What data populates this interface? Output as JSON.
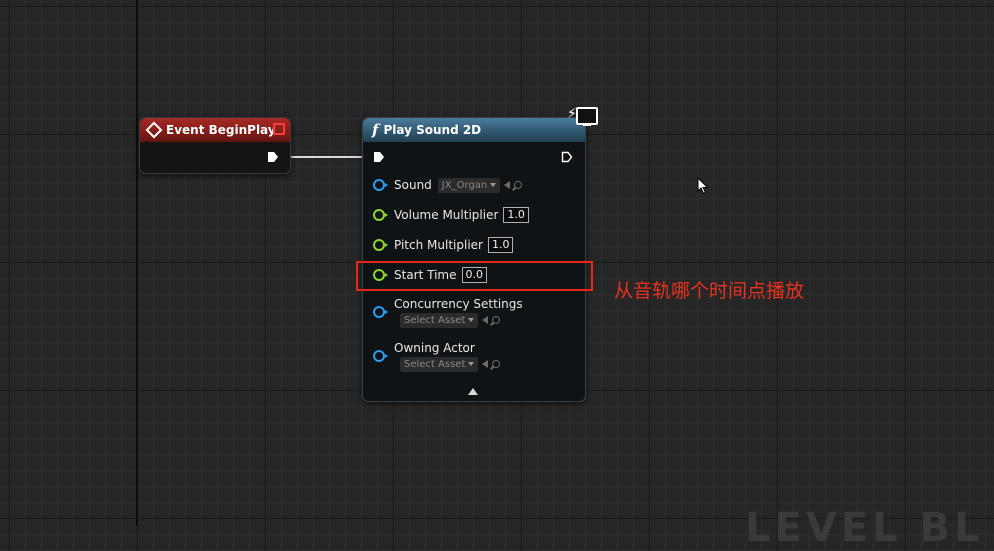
{
  "event_node": {
    "title": "Event BeginPlay"
  },
  "function_node": {
    "title": "Play Sound 2D",
    "icon": "function-icon",
    "pins": {
      "sound": {
        "label": "Sound",
        "value": "JX_Organ"
      },
      "volume_multiplier": {
        "label": "Volume Multiplier",
        "value": "1.0"
      },
      "pitch_multiplier": {
        "label": "Pitch Multiplier",
        "value": "1.0"
      },
      "start_time": {
        "label": "Start Time",
        "value": "0.0"
      },
      "concurrency_settings": {
        "label": "Concurrency Settings",
        "value": "Select Asset"
      },
      "owning_actor": {
        "label": "Owning Actor",
        "value": "Select Asset"
      }
    }
  },
  "annotation": {
    "text": "从音轨哪个时间点播放"
  },
  "watermark": {
    "text": "LEVEL BL"
  },
  "colors": {
    "event_header": "#a52a24",
    "function_header": "#3d6a88",
    "object_pin": "#2a9ef0",
    "float_pin": "#8bd82e",
    "highlight": "#e8251b"
  }
}
